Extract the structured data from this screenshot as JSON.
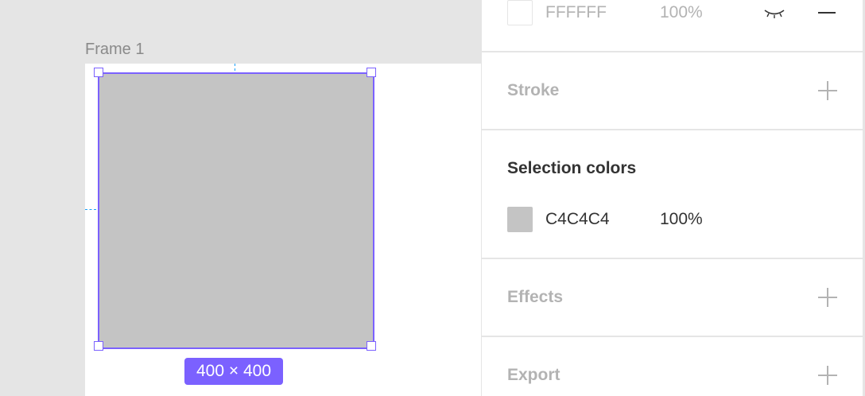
{
  "canvas": {
    "frame_label": "Frame 1",
    "size_badge": "400 × 400"
  },
  "panel": {
    "fill": {
      "hex": "FFFFFF",
      "opacity": "100%"
    },
    "stroke": {
      "title": "Stroke"
    },
    "selection_colors": {
      "title": "Selection colors",
      "items": [
        {
          "hex": "C4C4C4",
          "opacity": "100%"
        }
      ]
    },
    "effects": {
      "title": "Effects"
    },
    "export": {
      "title": "Export"
    }
  },
  "colors": {
    "selection_accent": "#7b61ff",
    "guide_blue": "#18a0fb",
    "shape_fill": "#c4c4c4",
    "canvas_bg": "#e5e5e5"
  },
  "icons": [
    "eye-closed-icon",
    "minus-icon",
    "plus-icon"
  ]
}
